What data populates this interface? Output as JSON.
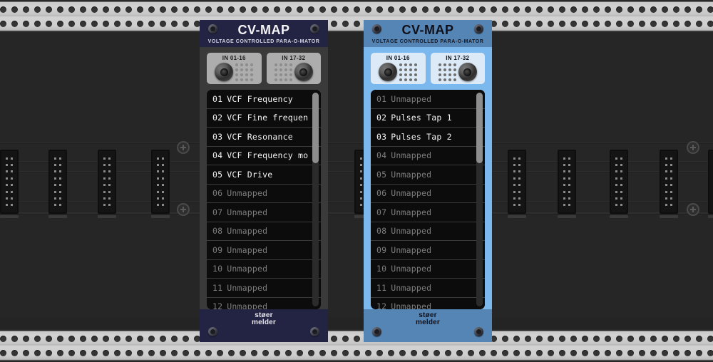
{
  "rack": {
    "plus_button_label": "+",
    "bus_header_name": "power-bus-header"
  },
  "modules": [
    {
      "id": "module-left",
      "theme": "dark",
      "title": "CV-MAP",
      "subtitle": "VOLTAGE CONTROLLED PARA-O-MATOR",
      "brand_line1": "støer",
      "brand_line2": "melder",
      "jacks": [
        {
          "label": "IN 01-16",
          "mirrored": false
        },
        {
          "label": "IN 17-32",
          "mirrored": true
        }
      ],
      "list": [
        {
          "num": "01",
          "label": "VCF Frequency",
          "mapped": true
        },
        {
          "num": "02",
          "label": "VCF Fine frequen",
          "mapped": true
        },
        {
          "num": "03",
          "label": "VCF Resonance",
          "mapped": true
        },
        {
          "num": "04",
          "label": "VCF Frequency mo",
          "mapped": true
        },
        {
          "num": "05",
          "label": "VCF Drive",
          "mapped": true
        },
        {
          "num": "06",
          "label": "Unmapped",
          "mapped": false
        },
        {
          "num": "07",
          "label": "Unmapped",
          "mapped": false
        },
        {
          "num": "08",
          "label": "Unmapped",
          "mapped": false
        },
        {
          "num": "09",
          "label": "Unmapped",
          "mapped": false
        },
        {
          "num": "10",
          "label": "Unmapped",
          "mapped": false
        },
        {
          "num": "11",
          "label": "Unmapped",
          "mapped": false
        },
        {
          "num": "12",
          "label": "Unmapped",
          "mapped": false
        }
      ]
    },
    {
      "id": "module-right",
      "theme": "blue",
      "title": "CV-MAP",
      "subtitle": "VOLTAGE CONTROLLED PARA-O-MATOR",
      "brand_line1": "støer",
      "brand_line2": "melder",
      "jacks": [
        {
          "label": "IN 01-16",
          "mirrored": false
        },
        {
          "label": "IN 17-32",
          "mirrored": true
        }
      ],
      "list": [
        {
          "num": "01",
          "label": "Unmapped",
          "mapped": false
        },
        {
          "num": "02",
          "label": "Pulses Tap 1",
          "mapped": true
        },
        {
          "num": "03",
          "label": "Pulses Tap 2",
          "mapped": true
        },
        {
          "num": "04",
          "label": "Unmapped",
          "mapped": false
        },
        {
          "num": "05",
          "label": "Unmapped",
          "mapped": false
        },
        {
          "num": "06",
          "label": "Unmapped",
          "mapped": false
        },
        {
          "num": "07",
          "label": "Unmapped",
          "mapped": false
        },
        {
          "num": "08",
          "label": "Unmapped",
          "mapped": false
        },
        {
          "num": "09",
          "label": "Unmapped",
          "mapped": false
        },
        {
          "num": "10",
          "label": "Unmapped",
          "mapped": false
        },
        {
          "num": "11",
          "label": "Unmapped",
          "mapped": false
        },
        {
          "num": "12",
          "label": "Unmapped",
          "mapped": false
        }
      ]
    }
  ],
  "colors": {
    "rail": "#cccccc",
    "case_interior": "#262626",
    "module_dark_header": "#232344",
    "module_dark_body": "#3a3a3a",
    "module_blue_header": "#5585b5",
    "module_blue_body": "#7ab8ee",
    "list_background": "#0c0c0c",
    "text_mapped": "#f2f2f2",
    "text_unmapped": "#7d7d7d"
  }
}
